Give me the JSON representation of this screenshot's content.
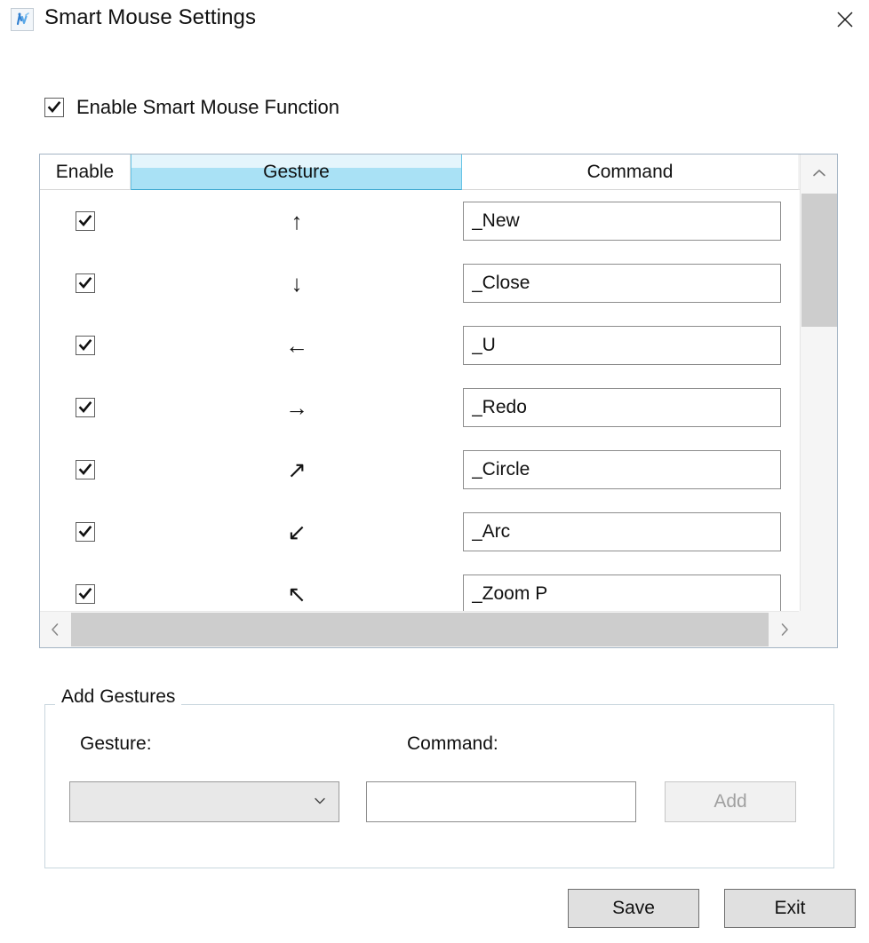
{
  "window": {
    "title": "Smart Mouse Settings",
    "icon": "smart-mouse-icon",
    "close_icon": "close-icon"
  },
  "enable": {
    "label": "Enable Smart Mouse Function",
    "checked": true
  },
  "grid": {
    "columns": [
      "Enable",
      "Gesture",
      "Command"
    ],
    "highlighted_column": "Gesture",
    "highlight_color": "#a9e1f5",
    "rows": [
      {
        "enabled": true,
        "gesture": "↑",
        "gesture_name": "arrow-up",
        "command": "_New"
      },
      {
        "enabled": true,
        "gesture": "↓",
        "gesture_name": "arrow-down",
        "command": "_Close"
      },
      {
        "enabled": true,
        "gesture": "←",
        "gesture_name": "arrow-left",
        "command": "_U"
      },
      {
        "enabled": true,
        "gesture": "→",
        "gesture_name": "arrow-right",
        "command": "_Redo"
      },
      {
        "enabled": true,
        "gesture": "↗",
        "gesture_name": "arrow-up-right",
        "command": "_Circle"
      },
      {
        "enabled": true,
        "gesture": "↙",
        "gesture_name": "arrow-down-left",
        "command": "_Arc"
      },
      {
        "enabled": true,
        "gesture": "↖",
        "gesture_name": "arrow-up-left",
        "command": "_Zoom P"
      }
    ],
    "scroll_up_icon": "chevron-up-icon",
    "scroll_down_icon": "chevron-down-icon",
    "scroll_left_icon": "chevron-left-icon",
    "scroll_right_icon": "chevron-right-icon"
  },
  "add_gestures": {
    "group_title": "Add Gestures",
    "gesture_label": "Gesture:",
    "command_label": "Command:",
    "gesture_select_value": "",
    "gesture_select_caret": "chevron-down-icon",
    "command_value": "",
    "command_placeholder": "",
    "add_button": "Add",
    "add_button_enabled": false
  },
  "footer": {
    "save_label": "Save",
    "exit_label": "Exit"
  }
}
